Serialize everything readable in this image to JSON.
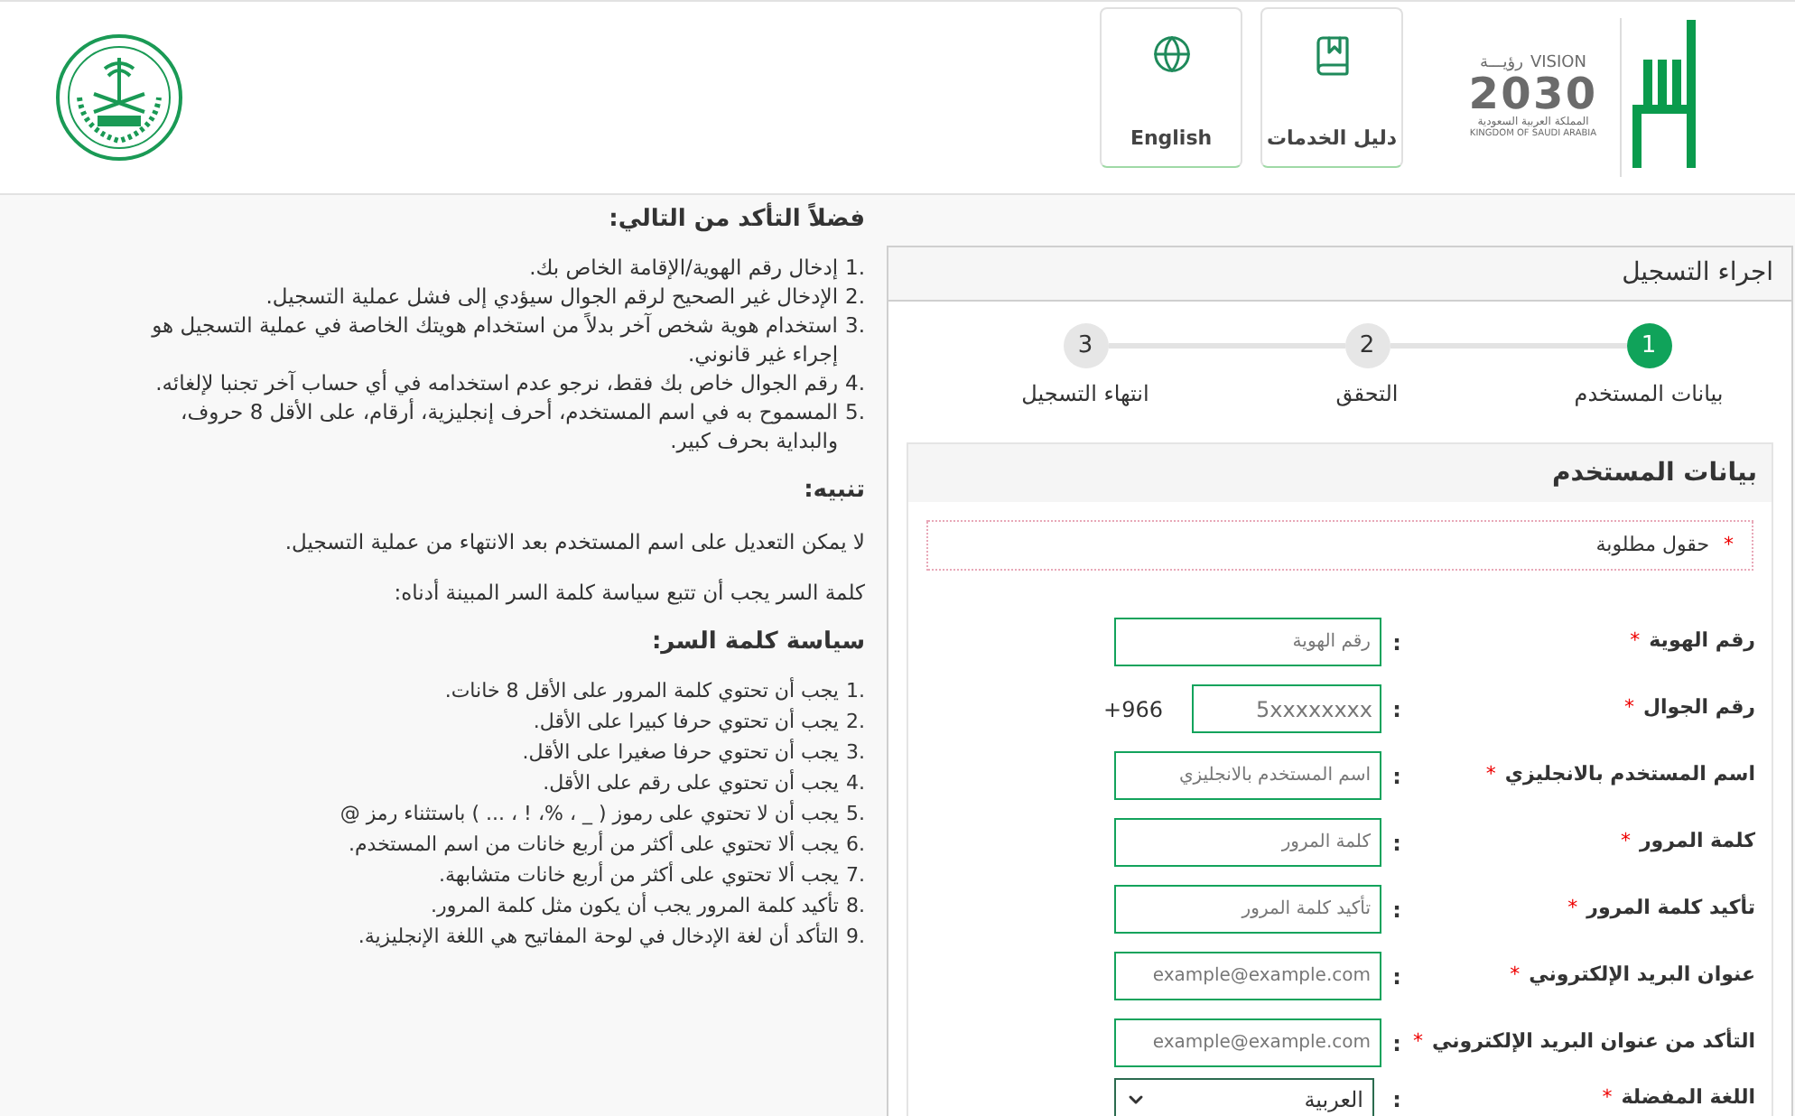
{
  "header": {
    "vision_logo": {
      "word_ar": "رؤيـــة",
      "word_en": "VISION",
      "year": "2030",
      "country_ar": "المملكة العربية السعودية",
      "country_en": "KINGDOM OF SAUDI ARABIA"
    },
    "nav_buttons": [
      {
        "label": "دليل الخدمات",
        "kind": "book"
      },
      {
        "label": "English",
        "kind": "globe"
      }
    ]
  },
  "registration": {
    "title": "اجراء التسجيل",
    "steps": [
      {
        "number": "1",
        "label": "بيانات المستخدم",
        "selected": true
      },
      {
        "number": "2",
        "label": "التحقق",
        "selected": false
      },
      {
        "number": "3",
        "label": "انتهاء التسجيل",
        "selected": false
      }
    ],
    "section_title": "بيانات المستخدم",
    "required_mark": "*",
    "required_note": "حقول مطلوبة",
    "separator": ":",
    "fields": [
      {
        "kind": "text",
        "label": "رقم الهوية",
        "required": true,
        "placeholder": "رقم الهوية"
      },
      {
        "kind": "phone",
        "label": "رقم الجوال",
        "required": true,
        "placeholder": "5xxxxxxxx",
        "prefix": "+966"
      },
      {
        "kind": "text",
        "label": "اسم المستخدم بالانجليزي",
        "required": true,
        "placeholder": "اسم المستخدم بالانجليزي"
      },
      {
        "kind": "text",
        "label": "كلمة المرور",
        "required": true,
        "placeholder": "كلمة المرور"
      },
      {
        "kind": "text",
        "label": "تأكيد كلمة المرور",
        "required": true,
        "placeholder": "تأكيد كلمة المرور"
      },
      {
        "kind": "text",
        "label": "عنوان البريد الإلكتروني",
        "required": true,
        "placeholder": "example@example.com"
      },
      {
        "kind": "text",
        "label": "التأكد من عنوان البريد الإلكتروني",
        "required": true,
        "placeholder": "example@example.com"
      },
      {
        "kind": "select",
        "label": "اللغة المفضلة",
        "required": true,
        "value": "العربية"
      }
    ]
  },
  "instructions": {
    "heading": "فضلاً التأكد من التالي:",
    "items": [
      {
        "number": "1.",
        "text": "إدخال رقم الهوية/الإقامة الخاص بك."
      },
      {
        "number": "2.",
        "text": "الإدخال غير الصحيح لرقم الجوال سيؤدي إلى فشل عملية التسجيل."
      },
      {
        "number": "3.",
        "text": "استخدام هوية شخص آخر بدلاً من استخدام هويتك الخاصة في عملية التسجيل هو إجراء غير قانوني."
      },
      {
        "number": "4.",
        "text": "رقم الجوال خاص بك فقط، نرجو عدم استخدامه في أي حساب آخر تجنبا لإلغائه."
      },
      {
        "number": "5.",
        "text": "المسموح به في اسم المستخدم، أحرف إنجليزية، أرقام، على الأقل 8 حروف، والبداية بحرف كبير."
      }
    ],
    "warning_heading": "تنبيه:",
    "warning_text": "لا يمكن التعديل على اسم المستخدم بعد الانتهاء من عملية التسجيل.",
    "password_note": "كلمة السر يجب أن تتبع سياسة كلمة السر المبينة أدناه:",
    "policy_heading": "سياسة كلمة السر:",
    "policy_items": [
      {
        "number": "1.",
        "text": "يجب أن تحتوي كلمة المرور على الأقل 8 خانات."
      },
      {
        "number": "2.",
        "text": "يجب أن تحتوي حرفا كبيرا على الأقل."
      },
      {
        "number": "3.",
        "text": "يجب أن تحتوي حرفا صغيرا على الأقل."
      },
      {
        "number": "4.",
        "text": "يجب أن تحتوي على رقم على الأقل."
      },
      {
        "number": "5.",
        "text": "يجب أن لا تحتوي على رموز ( _ ، %، ! ، ... ) باستثناء رمز @"
      },
      {
        "number": "6.",
        "text": "يجب ألا تحتوي على أكثر من أربع خانات من اسم المستخدم."
      },
      {
        "number": "7.",
        "text": "يجب ألا تحتوي على أكثر من أربع خانات متشابهة."
      },
      {
        "number": "8.",
        "text": "تأكيد كلمة المرور يجب أن يكون مثل كلمة المرور."
      },
      {
        "number": "9.",
        "text": "التأكد أن لغة الإدخال في لوحة المفاتيح هي اللغة الإنجليزية."
      }
    ]
  }
}
